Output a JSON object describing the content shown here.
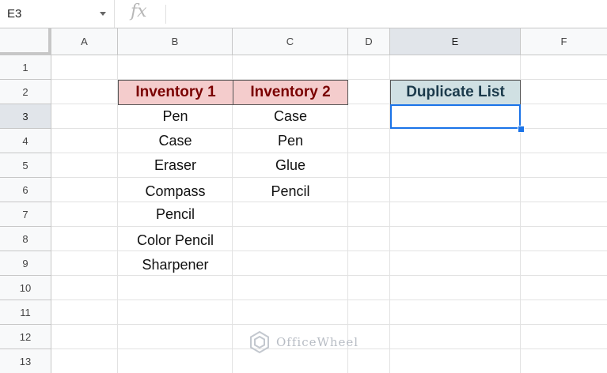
{
  "formula_bar": {
    "cell_reference": "E3",
    "fx_label": "fx",
    "formula": ""
  },
  "columns": [
    "A",
    "B",
    "C",
    "D",
    "E",
    "F"
  ],
  "rows": [
    "1",
    "2",
    "3",
    "4",
    "5",
    "6",
    "7",
    "8",
    "9",
    "10",
    "11",
    "12",
    "13"
  ],
  "selected_cell": "E3",
  "headers": {
    "inventory1": "Inventory 1",
    "inventory2": "Inventory 2",
    "duplicate_list": "Duplicate List"
  },
  "inventory1": [
    "Pen",
    "Case",
    "Eraser",
    "Compass",
    "Pencil",
    "Color Pencil",
    "Sharpener"
  ],
  "inventory2": [
    "Case",
    "Pen",
    "Glue",
    "Pencil"
  ],
  "colors": {
    "inventory_header_bg": "#f4cccc",
    "inventory_header_text": "#7a0000",
    "duplicate_header_bg": "#d0e0e3",
    "selection": "#1a73e8"
  },
  "watermark": "OfficeWheel"
}
